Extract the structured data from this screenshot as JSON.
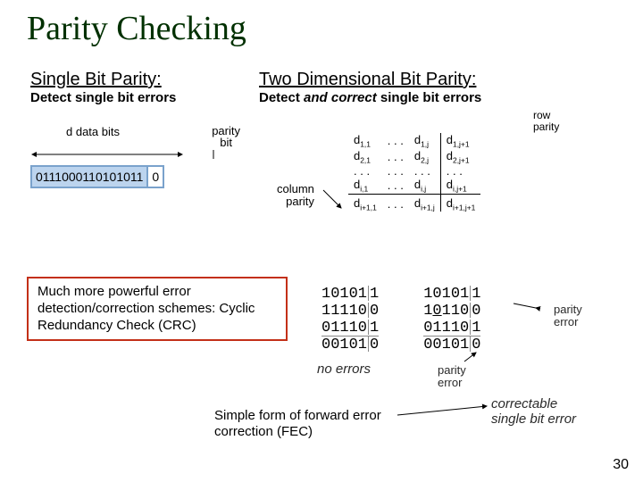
{
  "slide": {
    "title": "Parity Checking",
    "number": "30"
  },
  "single_bit": {
    "heading": "Single Bit Parity:",
    "sub": "Detect single bit errors",
    "data_bits_label": "d data bits",
    "parity_bit_label": "parity\nbit",
    "bits_value": "0111000110101011",
    "parity_value": "0"
  },
  "two_d": {
    "heading": "Two Dimensional Bit Parity:",
    "sub_lead": "Detect ",
    "sub_em": "and correct",
    "sub_tail": " single bit errors",
    "row_parity_label": "row\nparity",
    "column_parity_label": "column\nparity",
    "matrix": [
      [
        "d1,1",
        ". . .",
        "d1,j",
        "d1,j+1"
      ],
      [
        "d2,1",
        ". . .",
        "d2,j",
        "d2,j+1"
      ],
      [
        ". . .",
        ". . .",
        ". . .",
        ". . ."
      ],
      [
        "di,1",
        ". . .",
        "di,j",
        "di,j+1"
      ],
      [
        "di+1,1",
        ". . .",
        "di+1,j",
        "di+1,j+1"
      ]
    ]
  },
  "callout": {
    "text": "Much more powerful error detection/correction schemes: Cyclic Redundancy Check (CRC)"
  },
  "examples": {
    "no_errors": {
      "rows": [
        "10101 1",
        "11110 0",
        "01110 1",
        "00101 0"
      ],
      "caption": "no errors"
    },
    "with_error": {
      "rows": [
        "10101 1",
        "10110 0",
        "01110 1",
        "00101 0"
      ],
      "parity_error_label": "parity\nerror",
      "parity_error_label2": "parity\nerror",
      "correctable_label": "correctable\nsingle bit error"
    }
  },
  "fec": {
    "text": "Simple form of forward error correction (FEC)"
  }
}
